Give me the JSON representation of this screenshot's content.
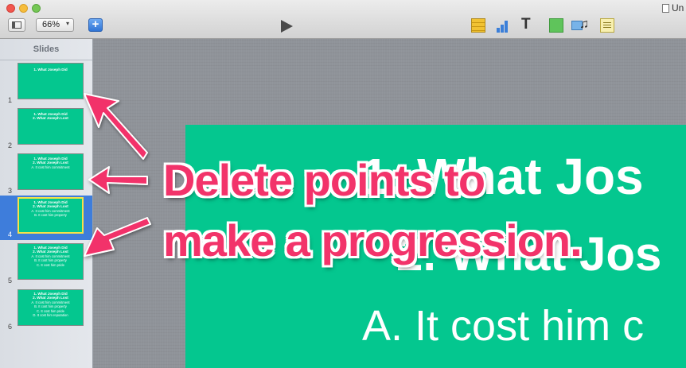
{
  "toolbar": {
    "zoom_value": "66%",
    "add_label": "+",
    "text_tool_label": "T",
    "document_title": "Un"
  },
  "sidebar": {
    "header": "Slides",
    "slides": [
      {
        "number": "1",
        "lines": [
          "1. What Joseph Did"
        ],
        "sub": []
      },
      {
        "number": "2",
        "lines": [
          "1. What Joseph Did",
          "2. What Joseph Lost"
        ],
        "sub": []
      },
      {
        "number": "3",
        "lines": [
          "1. What Joseph Did",
          "2. What Joseph Lost"
        ],
        "sub": [
          "A. It cost him commitment"
        ]
      },
      {
        "number": "4",
        "lines": [
          "1. What Joseph Did",
          "2. What Joseph Lost"
        ],
        "sub": [
          "A. It cost him commitment",
          "B. It cost him property"
        ]
      },
      {
        "number": "5",
        "lines": [
          "1. What Joseph Did",
          "2. What Joseph Lost"
        ],
        "sub": [
          "A. It cost him commitment",
          "B. It cost him property",
          "C. It cost him pride"
        ]
      },
      {
        "number": "6",
        "lines": [
          "1. What Joseph Did",
          "2. What Joseph Lost"
        ],
        "sub": [
          "A. It cost him commitment",
          "B. It cost him property",
          "C. It cost him pride",
          "D. It cost him reputation"
        ]
      }
    ],
    "selected_index": 3
  },
  "slide": {
    "line1": "1. What Jos",
    "line2": "2. What Jos",
    "line3": "A.  It cost him c"
  },
  "annotation": {
    "line1": "Delete points to",
    "line2": "make a progression.",
    "color": "#f2336a"
  },
  "colors": {
    "slide_background": "#04c78f",
    "selection": "#3e7ddb",
    "selected_thumb_border": "#f7e14a"
  }
}
